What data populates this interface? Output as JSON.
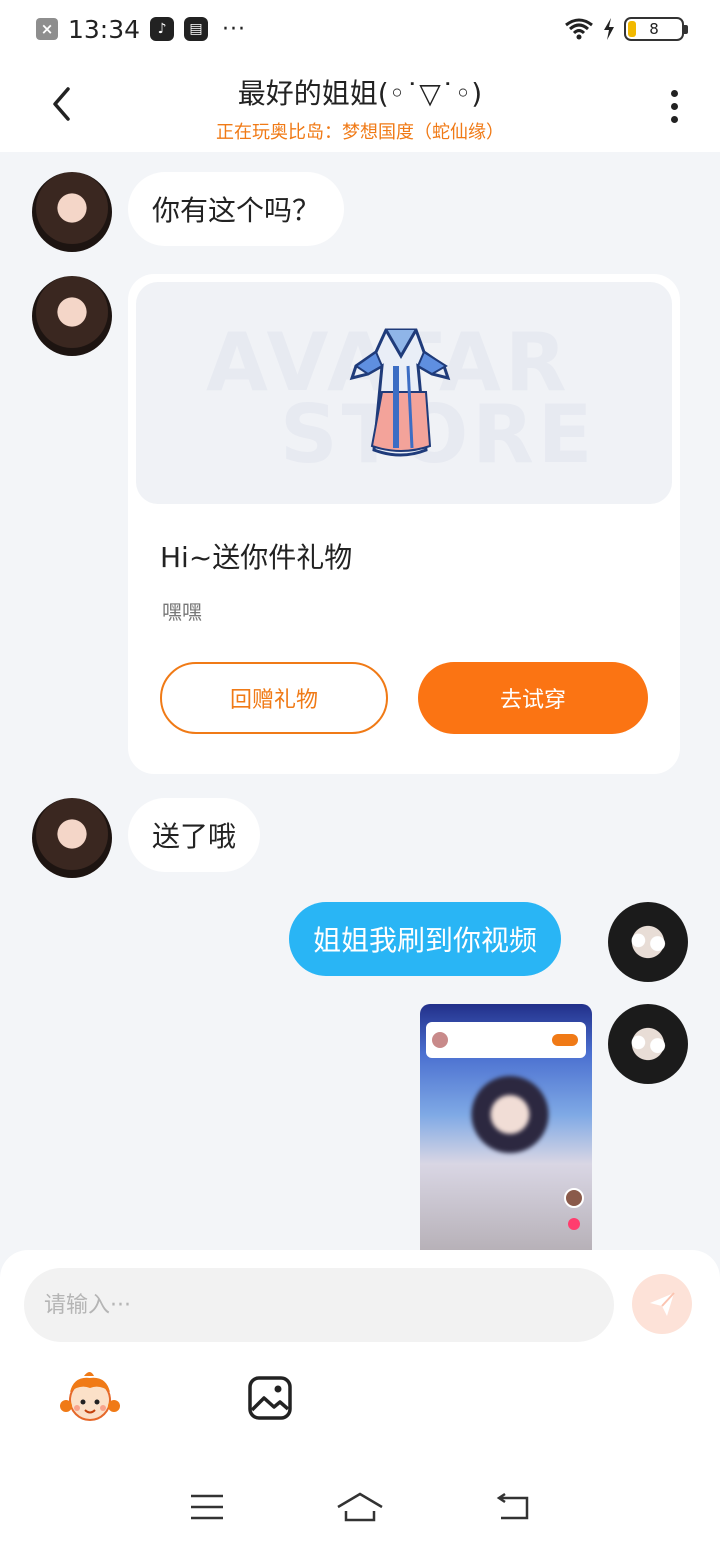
{
  "status_bar": {
    "time": "13:34",
    "dots": "···",
    "battery_level": "8",
    "notification_icon": "close-box-icon",
    "app_icons": [
      "tiktok-icon",
      "message-box-icon"
    ]
  },
  "header": {
    "title": "最好的姐姐(◦˙▽˙◦)",
    "subtitle": "正在玩奥比岛：梦想国度（蛇仙缘）"
  },
  "messages": [
    {
      "from": "her",
      "type": "text",
      "text": "你有这个吗？"
    },
    {
      "from": "her",
      "type": "gift_card",
      "title": "Hi~送你件礼物",
      "subtitle": "嘿嘿",
      "return_gift_label": "回赠礼物",
      "try_on_label": "去试穿",
      "watermark": [
        "AVATAR",
        "STORE"
      ]
    },
    {
      "from": "her",
      "type": "text",
      "text": "送了哦"
    },
    {
      "from": "me",
      "type": "text",
      "text": "姐姐我刷到你视频"
    },
    {
      "from": "me",
      "type": "video_thumbnail"
    }
  ],
  "composer": {
    "placeholder": "请输入···",
    "send_icon": "send-icon",
    "emoji_icon": "mascot-emoji-icon",
    "image_icon": "image-icon"
  },
  "nav_bar": {
    "items": [
      "menu-icon",
      "home-icon",
      "back-icon"
    ]
  },
  "colors": {
    "accent": "#fb7413",
    "subtitle": "#f07a16",
    "my_bubble": "#29b5f5",
    "background": "#f3f5f8"
  }
}
